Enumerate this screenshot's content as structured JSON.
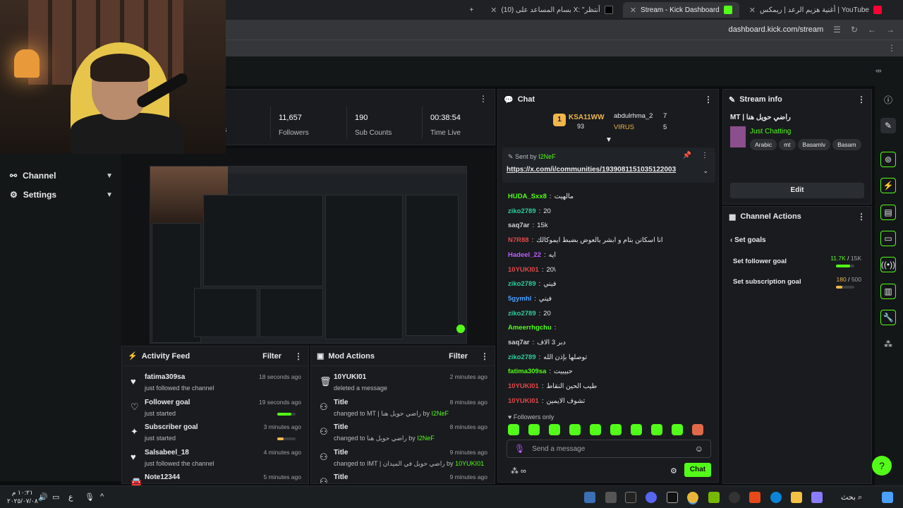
{
  "browser": {
    "tabs": [
      {
        "label": "أغنية هزيم الرعد | ريمكس | YouTube",
        "active": false
      },
      {
        "label": "Stream - Kick Dashboard",
        "active": true
      },
      {
        "label": "(10) بسام المساعد على X: \"أنتظر",
        "active": false
      }
    ],
    "new_tab": "+",
    "url": "dashboard.kick.com/stream"
  },
  "sidebar": {
    "items": [
      {
        "label": "Channel"
      },
      {
        "label": "Settings"
      }
    ]
  },
  "stats": [
    {
      "value": "",
      "label": "rs"
    },
    {
      "value": "11,657",
      "label": "Followers"
    },
    {
      "value": "190",
      "label": "Sub Counts"
    },
    {
      "value": "00:38:54",
      "label": "Time Live"
    }
  ],
  "activity_feed": {
    "title": "Activity Feed",
    "filter": "Filter",
    "items": [
      {
        "icon": "heart-icon",
        "name": "fatima309sa",
        "desc": "just followed the channel",
        "time": "18 seconds ago"
      },
      {
        "icon": "heart-outline-icon",
        "name": "Follower goal",
        "desc": "just started",
        "time": "19 seconds ago",
        "progress": 0.78
      },
      {
        "icon": "sparkle-icon",
        "name": "Subscriber goal",
        "desc": "just started",
        "time": "3 minutes ago",
        "progress": 0.36
      },
      {
        "icon": "heart-icon",
        "name": "Salsabeel_18",
        "desc": "just followed the channel",
        "time": "4 minutes ago"
      },
      {
        "icon": "car-icon",
        "name": "Note12344",
        "desc": "",
        "time": "5 minutes ago"
      }
    ]
  },
  "mod_actions": {
    "title": "Mod Actions",
    "filter": "Filter",
    "items": [
      {
        "icon": "trash-icon",
        "name": "10YUKI01",
        "desc": "deleted a message",
        "by": "",
        "time": "2 minutes ago"
      },
      {
        "icon": "user-edit-icon",
        "name": "Title",
        "desc": "changed to MT | راضي حويل هنا",
        "by": "I2NeF",
        "time": "8 minutes ago"
      },
      {
        "icon": "user-edit-icon",
        "name": "Title",
        "desc": "changed to راضي حويل هنا",
        "by": "I2NeF",
        "time": "8 minutes ago"
      },
      {
        "icon": "user-edit-icon",
        "name": "Title",
        "desc": "changed to IMT | راضي حويل في الميدان",
        "by": "10YUKI01",
        "time": "9 minutes ago"
      },
      {
        "icon": "user-edit-icon",
        "name": "Title",
        "desc": "",
        "by": "",
        "time": "9 minutes ago"
      }
    ]
  },
  "chat": {
    "title": "Chat",
    "leaderboard": [
      {
        "name": "KSA11WW",
        "count": "93"
      },
      {
        "name": "abdulrhma_2",
        "count": "7"
      },
      {
        "name": "VIRUS",
        "count": "5"
      }
    ],
    "pinned": {
      "sent_by_label": "Sent by",
      "sender": "I2NeF",
      "link": "https://x.com/i/communities/1939081151035122003"
    },
    "messages": [
      {
        "user": "HUDA_Sxx8",
        "text": "مالهيت",
        "color": "#53fc18"
      },
      {
        "user": "ziko2789",
        "text": "20",
        "color": "#2ecc9a"
      },
      {
        "user": "saq7ar",
        "text": "15k",
        "color": "#d0d3d6"
      },
      {
        "user": "N7R88",
        "text": "انا اسكانن بتام و ابشر بالعوض بضبط ايموكالك",
        "color": "#e04848"
      },
      {
        "user": "Hadeel_22",
        "text": "ايه",
        "color": "#c45bff"
      },
      {
        "user": "10YUKI01",
        "text": "20\\",
        "color": "#e04848"
      },
      {
        "user": "ziko2789",
        "text": "فيني",
        "color": "#2ecc9a"
      },
      {
        "user": "5gymhl",
        "text": "فيني",
        "color": "#4aa0ff"
      },
      {
        "user": "ziko2789",
        "text": "20",
        "color": "#2ecc9a"
      },
      {
        "user": "Ameerrhgchu",
        "text": "",
        "color": "#53fc18"
      },
      {
        "user": "saq7ar",
        "text": "دبر 3 الاف",
        "color": "#d0d3d6"
      },
      {
        "user": "ziko2789",
        "text": "توصلها بإذن الله",
        "color": "#2ecc9a"
      },
      {
        "user": "fatima309sa",
        "text": "حبيبيت",
        "color": "#53fc18"
      },
      {
        "user": "10YUKI01",
        "text": "طيب الحين النقاط",
        "color": "#e04848"
      },
      {
        "user": "10YUKI01",
        "text": "تشوف الايمين",
        "color": "#e04848"
      }
    ],
    "followers_only": "Followers only",
    "input_placeholder": "Send a message",
    "send_label": "Chat"
  },
  "stream_info": {
    "title": "Stream info",
    "stream_title": "MT | راضي حويل هنا",
    "category": "Just Chatting",
    "tags": [
      "Arabic",
      "mt",
      "Basamlv",
      "Basam"
    ],
    "edit_label": "Edit"
  },
  "channel_actions": {
    "title": "Channel Actions",
    "back_label": "Set goals",
    "goals": [
      {
        "label": "Set follower goal",
        "current": "11.7K",
        "target": "15K",
        "progress": 0.78,
        "color": "#53fc18"
      },
      {
        "label": "Set subscription goal",
        "current": "180",
        "target": "500",
        "progress": 0.36,
        "color": "#f0b64a"
      }
    ]
  },
  "taskbar": {
    "time": "١٠:٢١ م",
    "date": "٢٠٢٥/٠٧/٠٨",
    "search": "بحث",
    "lang": "ع"
  }
}
